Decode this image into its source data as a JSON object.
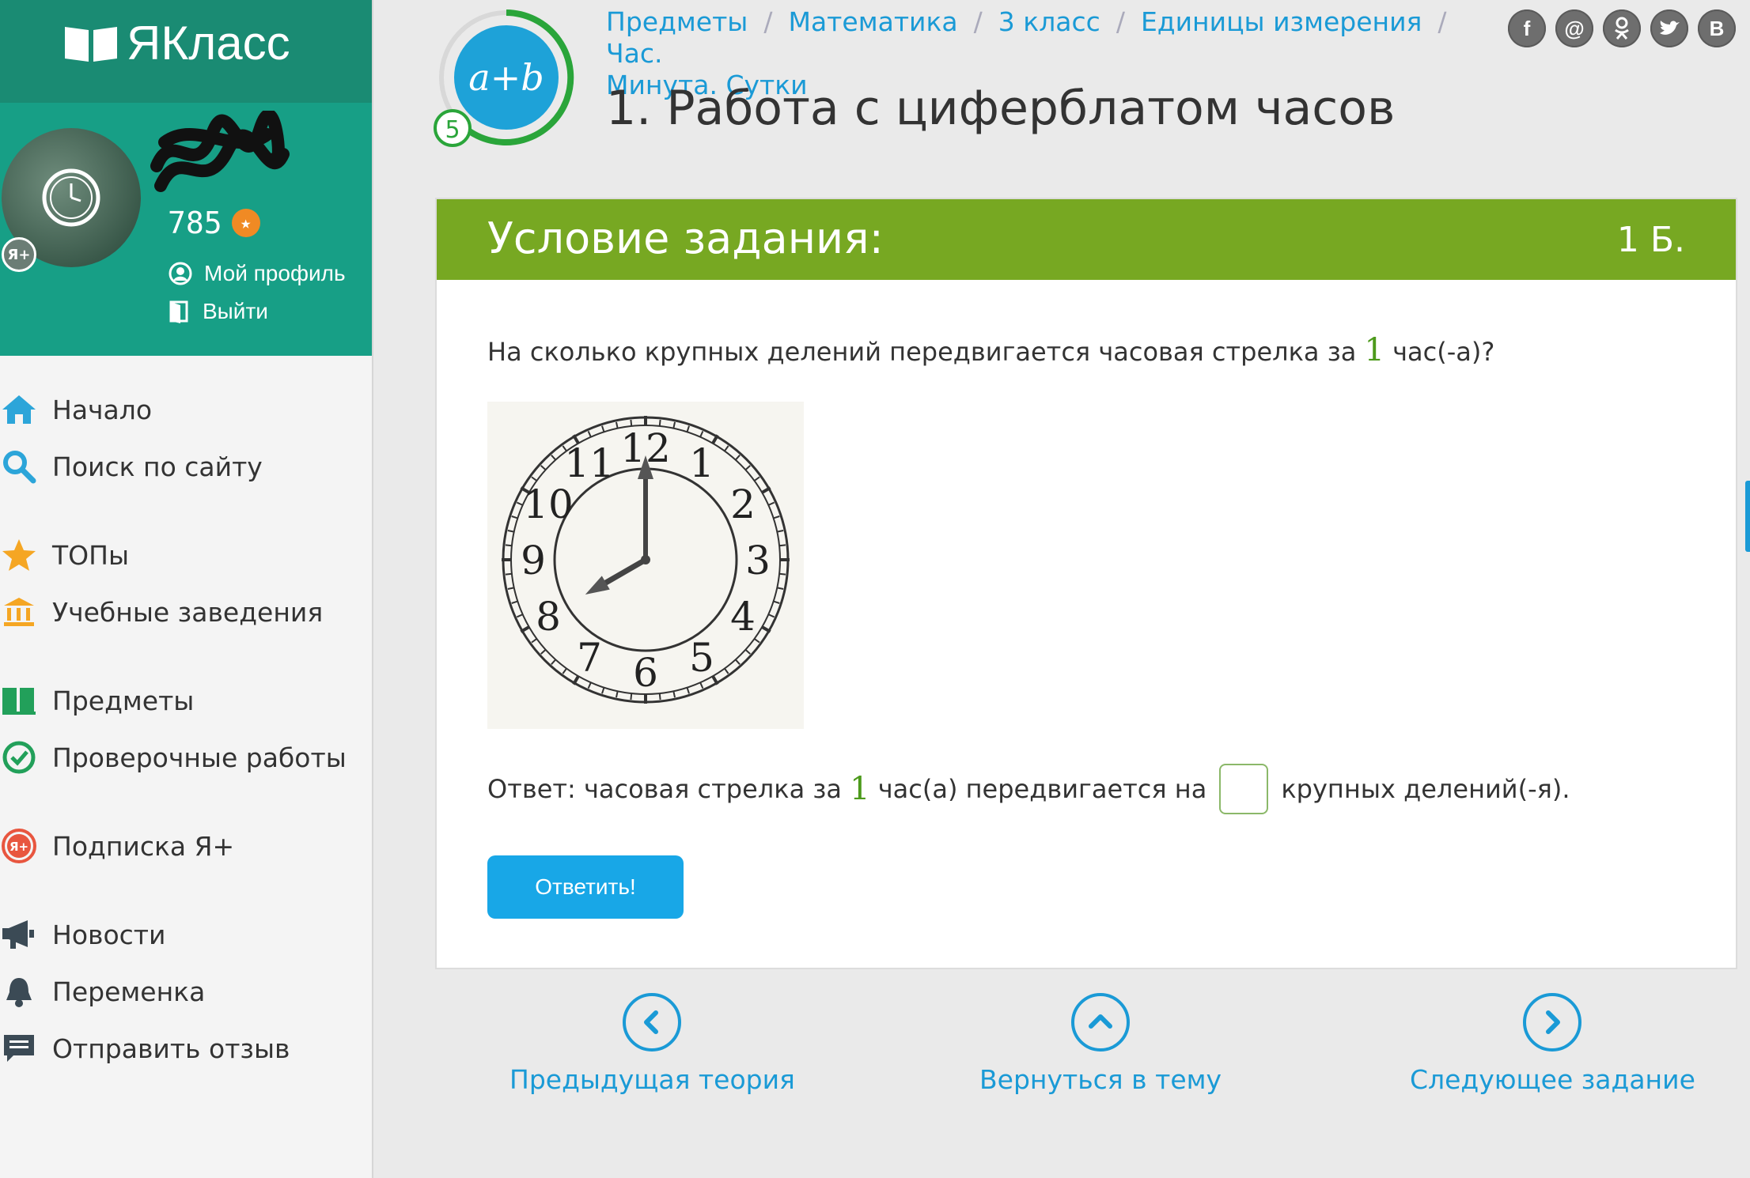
{
  "brand": {
    "name": "ЯКласс"
  },
  "user": {
    "score": "785",
    "badge": "Я+",
    "profile_link": "Мой профиль",
    "logout_link": "Выйти"
  },
  "nav": {
    "items": [
      {
        "label": "Начало",
        "icon": "home-icon"
      },
      {
        "label": "Поиск по сайту",
        "icon": "search-icon"
      },
      {
        "label": "ТОПы",
        "icon": "star-icon"
      },
      {
        "label": "Учебные заведения",
        "icon": "school-icon"
      },
      {
        "label": "Предметы",
        "icon": "books-icon"
      },
      {
        "label": "Проверочные работы",
        "icon": "check-circle-icon"
      },
      {
        "label": "Подписка Я+",
        "icon": "yaplus-icon"
      },
      {
        "label": "Новости",
        "icon": "megaphone-icon"
      },
      {
        "label": "Переменка",
        "icon": "bell-icon"
      },
      {
        "label": "Отправить отзыв",
        "icon": "feedback-icon"
      }
    ]
  },
  "topic_badge": {
    "formula": "a+b",
    "level": "5"
  },
  "breadcrumb": {
    "items": [
      "Предметы",
      "Математика",
      "3 класс",
      "Единицы измерения",
      "Час.",
      "Минута. Сутки"
    ]
  },
  "page": {
    "title": "1. Работа с циферблатом часов"
  },
  "share": {
    "buttons": [
      "f",
      "@",
      "ok",
      "tw",
      "В"
    ]
  },
  "task": {
    "header_title": "Условие задания:",
    "points": "1 Б.",
    "question_before": "На сколько крупных делений передвигается часовая стрелка за ",
    "question_number": "1",
    "question_after": " час(-а)?",
    "answer_before": "Ответ: часовая стрелка за ",
    "answer_number": "1",
    "answer_middle": " час(а) передвигается на",
    "answer_after": "крупных делений(-я).",
    "answer_value": "",
    "submit_label": "Ответить!",
    "clock": {
      "numerals": [
        "12",
        "1",
        "2",
        "3",
        "4",
        "5",
        "6",
        "7",
        "8",
        "9",
        "10",
        "11"
      ],
      "hour": 8,
      "minute": 0
    }
  },
  "bottom_nav": {
    "prev_label": "Предыдущая теория",
    "back_label": "Вернуться в тему",
    "next_label": "Следующее задание"
  },
  "colors": {
    "accent_teal": "#179f86",
    "task_green": "#77a822",
    "link_blue": "#1a9ad6",
    "button_blue": "#18a7e7"
  }
}
